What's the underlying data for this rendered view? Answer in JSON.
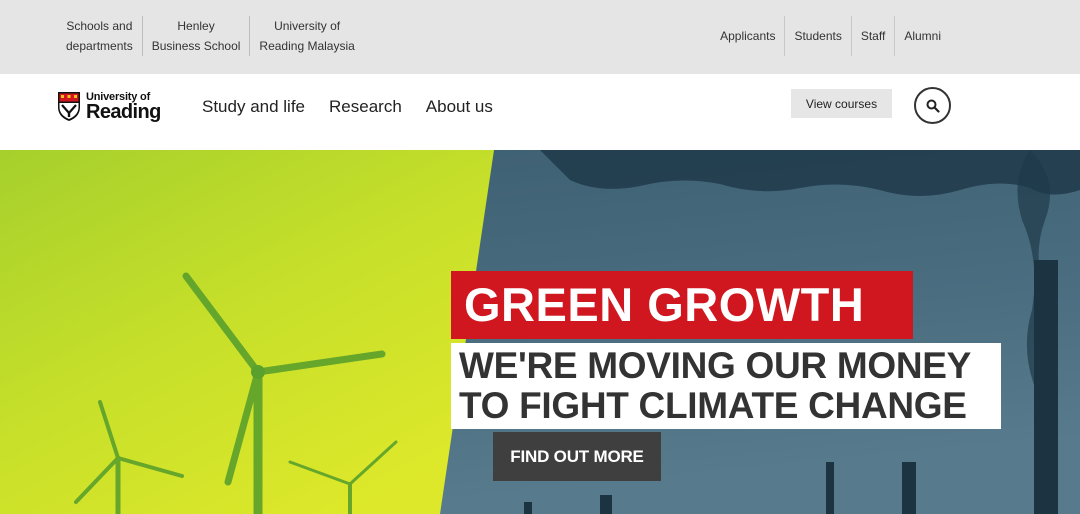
{
  "utility_nav": {
    "left_links": [
      {
        "line1": "Schools and",
        "line2": "departments"
      },
      {
        "line1": "Henley",
        "line2": "Business School"
      },
      {
        "line1": "University of",
        "line2": "Reading Malaysia"
      }
    ],
    "right_links": [
      "Applicants",
      "Students",
      "Staff",
      "Alumni"
    ]
  },
  "header": {
    "logo_small": "University of",
    "logo_big": "Reading",
    "nav": [
      "Study and life",
      "Research",
      "About us"
    ],
    "view_courses": "View courses"
  },
  "hero": {
    "headline": "GREEN GROWTH",
    "subheadline_line1": "WE'RE MOVING OUR MONEY",
    "subheadline_line2": "TO FIGHT CLIMATE CHANGE",
    "cta": "FIND OUT MORE"
  },
  "colors": {
    "utility_bg": "#e5e5e5",
    "brand_red": "#d0171f",
    "lime": "#c8e02a",
    "slate": "#3f6375",
    "cta_bg": "#3f3f3f"
  },
  "icons": [
    "crest-logo-icon",
    "search-icon"
  ]
}
